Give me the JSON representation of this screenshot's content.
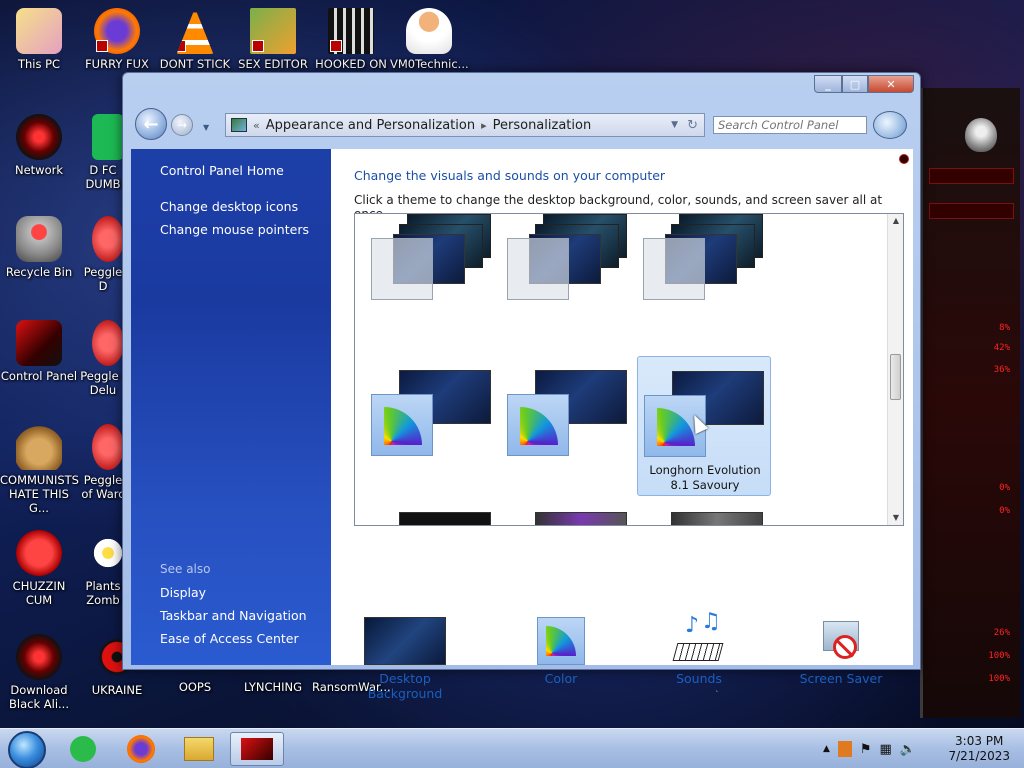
{
  "desktop": {
    "icons": [
      {
        "label": "This PC"
      },
      {
        "label": "FURRY FUX"
      },
      {
        "label": "DONT STICK"
      },
      {
        "label": "SEX EDITOR"
      },
      {
        "label": "HOOKED ON"
      },
      {
        "label": "VM0Technic..."
      },
      {
        "label": "Network"
      },
      {
        "label": "D FC DUMB"
      },
      {
        "label": "Recycle Bin"
      },
      {
        "label": "Peggle D"
      },
      {
        "label": "Control Panel"
      },
      {
        "label": "Peggle I Delu"
      },
      {
        "label": "COMMUNISTS HATE THIS G..."
      },
      {
        "label": "Peggle of Warc"
      },
      {
        "label": "CHUZZIN CUM"
      },
      {
        "label": "Plants Zomb"
      },
      {
        "label": "Download Black Ali..."
      },
      {
        "label": "UKRAINE"
      },
      {
        "label": "OOPS"
      },
      {
        "label": "LYNCHING"
      },
      {
        "label": "RansomWar..."
      }
    ],
    "gadget_readouts": [
      "8%",
      "42%",
      "36%",
      "0%",
      "0%",
      "26%",
      "100%",
      "100%"
    ]
  },
  "window": {
    "address": {
      "prefix": "«",
      "crumb1": "Appearance and Personalization",
      "crumb2": "Personalization"
    },
    "search": {
      "placeholder": "Search Control Panel"
    },
    "sidebar": {
      "home": "Control Panel Home",
      "links": [
        "Change desktop icons",
        "Change mouse pointers"
      ],
      "see_also": "See also",
      "see_also_links": [
        "Display",
        "Taskbar and Navigation",
        "Ease of Access Center"
      ]
    },
    "content": {
      "title": "Change the visuals and sounds on your computer",
      "subtitle": "Click a theme to change the desktop background, color, sounds, and screen saver all at once.",
      "selected_theme": "Longhorn Evolution 8.1 Savoury",
      "bottom": [
        {
          "label": "Desktop Background",
          "icon": "desktop-background-icon"
        },
        {
          "label": "Color",
          "icon": "color-icon"
        },
        {
          "label": "Sounds",
          "icon": "sounds-icon"
        },
        {
          "label": "Screen Saver",
          "icon": "screen-saver-icon"
        }
      ]
    }
  },
  "taskbar": {
    "time": "3:03 PM",
    "date": "7/21/2023"
  }
}
